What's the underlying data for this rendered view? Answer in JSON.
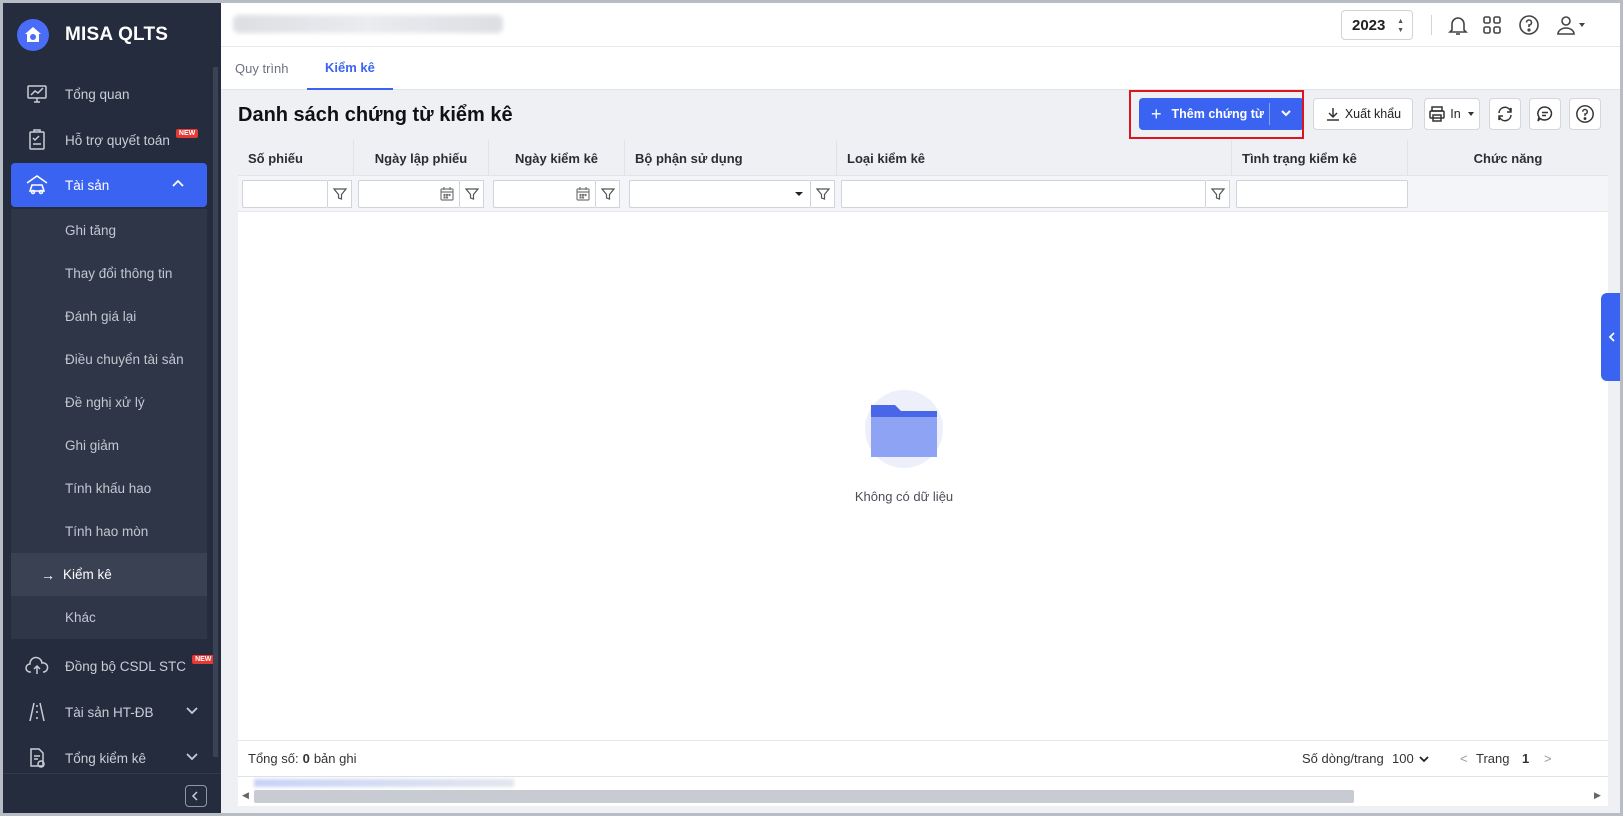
{
  "app": {
    "name": "MISA QLTS"
  },
  "sidebar": {
    "items": [
      {
        "label": "Tổng quan",
        "icon": "monitor-chart-icon"
      },
      {
        "label": "Hỗ trợ quyết toán",
        "icon": "clipboard-check-icon",
        "badge": "NEW"
      },
      {
        "label": "Tài sản",
        "icon": "car-house-icon"
      },
      {
        "label": "Đồng bộ CSDL STC",
        "icon": "cloud-upload-icon",
        "badge": "NEW"
      },
      {
        "label": "Tài sản HT-ĐB",
        "icon": "road-icon"
      },
      {
        "label": "Tổng kiểm kê",
        "icon": "document-check-icon"
      }
    ],
    "submenu": [
      "Ghi tăng",
      "Thay đổi thông tin",
      "Đánh giá lại",
      "Điều chuyển tài sản",
      "Đề nghị xử lý",
      "Ghi giảm",
      "Tính khấu hao",
      "Tính hao mòn",
      "Kiểm kê",
      "Khác"
    ]
  },
  "topbar": {
    "year": "2023"
  },
  "tabs": [
    {
      "label": "Quy trình"
    },
    {
      "label": "Kiểm kê"
    }
  ],
  "page": {
    "title": "Danh sách chứng từ kiểm kê",
    "add_button": "Thêm chứng từ",
    "export_button": "Xuất khẩu",
    "print_button": "In"
  },
  "grid": {
    "columns": [
      "Số phiếu",
      "Ngày lập phiếu",
      "Ngày kiểm kê",
      "Bộ phận sử dụng",
      "Loại kiểm kê",
      "Tình trạng kiểm kê",
      "Chức năng"
    ],
    "empty_text": "Không có dữ liệu"
  },
  "footer": {
    "total_label": "Tổng số:",
    "total_count": "0",
    "total_suffix": "bản ghi",
    "rows_per_page_label": "Số dòng/trang",
    "rows_per_page": "100",
    "page_label": "Trang",
    "page_number": "1"
  },
  "colors": {
    "primary": "#3a63f2",
    "sidebar": "#252c3d",
    "highlight": "#e0141e"
  }
}
